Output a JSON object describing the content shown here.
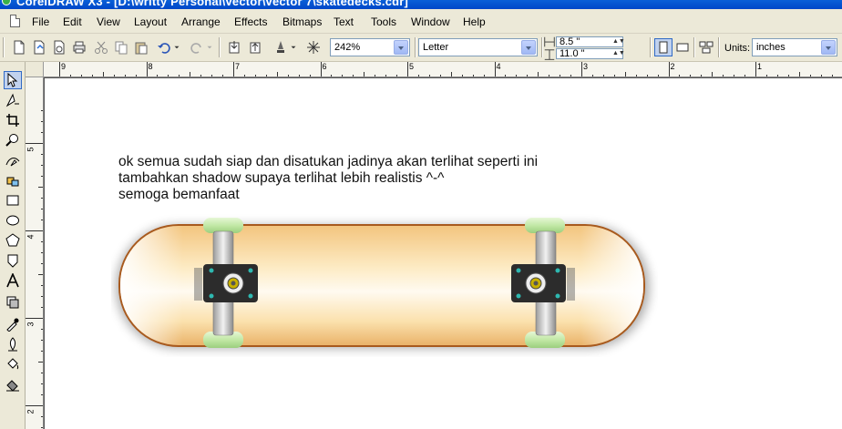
{
  "window": {
    "title": "CorelDRAW X3 - [D:\\writty Personal\\vector\\vector 7\\skatedecks.cdr]"
  },
  "menu": {
    "items": [
      {
        "label": "File"
      },
      {
        "label": "Edit"
      },
      {
        "label": "View"
      },
      {
        "label": "Layout"
      },
      {
        "label": "Arrange"
      },
      {
        "label": "Effects"
      },
      {
        "label": "Bitmaps"
      },
      {
        "label": "Text"
      },
      {
        "label": "Tools"
      },
      {
        "label": "Window"
      },
      {
        "label": "Help"
      }
    ]
  },
  "toolbar": {
    "zoom": "242%",
    "paper_size": "Letter",
    "width": "8.5 \"",
    "height": "11.0 \"",
    "units_label": "Units:",
    "units_value": "inches"
  },
  "rulers": {
    "horizontal_labels": [
      "9",
      "8",
      "7",
      "6",
      "5",
      "4",
      "3",
      "2",
      "1"
    ],
    "vertical_labels": [
      "5",
      "4",
      "3",
      "2"
    ]
  },
  "canvas": {
    "text_lines": [
      "ok semua sudah siap dan disatukan jadinya akan terlihat seperti ini",
      "tambahkan shadow supaya terlihat lebih realistis ^-^",
      "semoga bemanfaat"
    ]
  },
  "colors": {
    "title_bar": "#0a5fd8",
    "deck_center": "#fffaf0",
    "deck_edge": "#f0c27a",
    "deck_rim": "#a85a1e",
    "wheel": "#c2e8a6",
    "truck_base": "#2c2c2c",
    "bolt": "#2eb8b0"
  }
}
